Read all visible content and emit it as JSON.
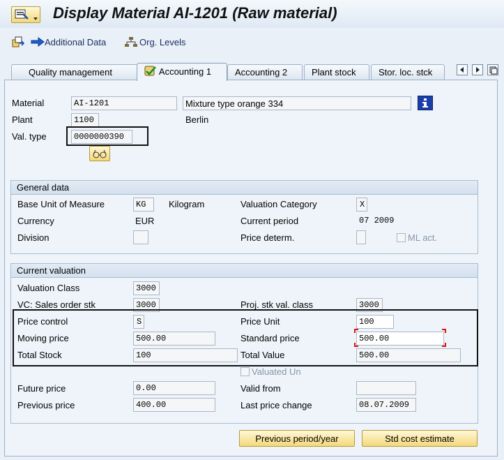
{
  "window": {
    "title": "Display Material AI-1201 (Raw material)"
  },
  "toolbar": {
    "additional_data": "Additional Data",
    "org_levels": "Org. Levels"
  },
  "tabs": [
    {
      "label": "Quality management"
    },
    {
      "label": "Accounting 1"
    },
    {
      "label": "Accounting 2"
    },
    {
      "label": "Plant stock"
    },
    {
      "label": "Stor. loc. stck"
    }
  ],
  "header": {
    "material_label": "Material",
    "material_value": "AI-1201",
    "material_desc": "Mixture type orange 334",
    "plant_label": "Plant",
    "plant_value": "1100",
    "plant_name": "Berlin",
    "valtype_label": "Val. type",
    "valtype_value": "0000000390"
  },
  "general": {
    "title": "General data",
    "base_uom_label": "Base Unit of Measure",
    "base_uom_value": "KG",
    "base_uom_text": "Kilogram",
    "val_cat_label": "Valuation Category",
    "val_cat_value": "X",
    "currency_label": "Currency",
    "currency_value": "EUR",
    "current_period_label": "Current period",
    "current_period_value": "07 2009",
    "division_label": "Division",
    "division_value": "",
    "price_determ_label": "Price determ.",
    "price_determ_value": "",
    "ml_act_label": "ML act."
  },
  "valuation": {
    "title": "Current valuation",
    "val_class_label": "Valuation Class",
    "val_class_value": "3000",
    "vc_sales_label": "VC: Sales order stk",
    "vc_sales_value": "3000",
    "proj_stk_label": "Proj. stk val. class",
    "proj_stk_value": "3000",
    "price_control_label": "Price control",
    "price_control_value": "S",
    "price_unit_label": "Price Unit",
    "price_unit_value": "100",
    "moving_price_label": "Moving price",
    "moving_price_value": "500.00",
    "standard_price_label": "Standard price",
    "standard_price_value": "500.00",
    "total_stock_label": "Total Stock",
    "total_stock_value": "100",
    "total_value_label": "Total Value",
    "total_value_value": "500.00",
    "valuated_un_label": "Valuated Un",
    "future_price_label": "Future price",
    "future_price_value": "0.00",
    "valid_from_label": "Valid from",
    "valid_from_value": "",
    "previous_price_label": "Previous price",
    "previous_price_value": "400.00",
    "last_change_label": "Last price change",
    "last_change_value": "08.07.2009"
  },
  "buttons": {
    "previous_period": "Previous period/year",
    "std_cost": "Std cost estimate"
  }
}
